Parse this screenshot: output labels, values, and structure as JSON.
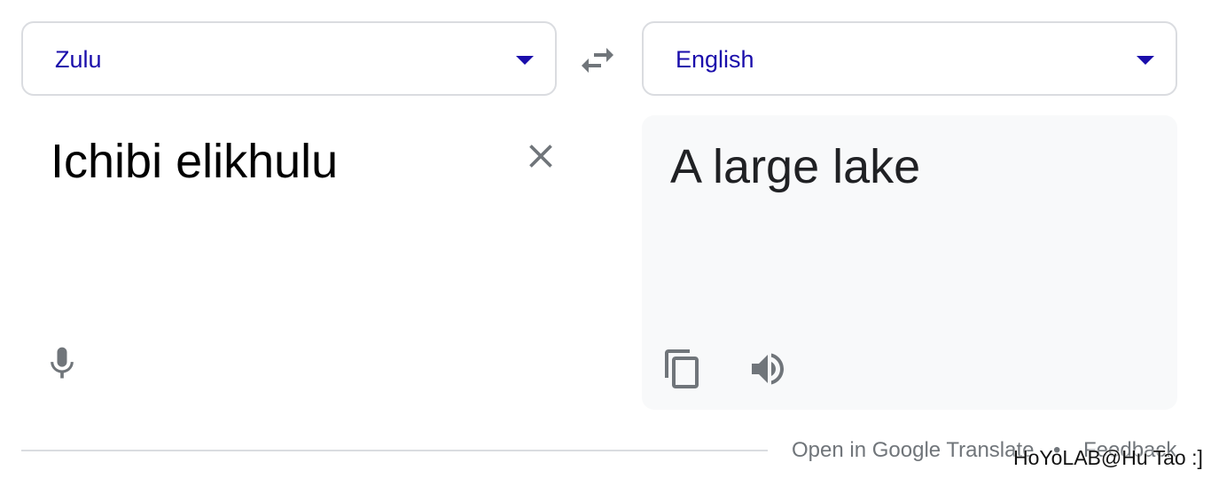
{
  "source_language": {
    "label": "Zulu"
  },
  "target_language": {
    "label": "English"
  },
  "input": {
    "text": "Ichibi elikhulu"
  },
  "output": {
    "text": "A large lake"
  },
  "footer": {
    "open_link": "Open in Google Translate",
    "separator": "•",
    "feedback_link": "Feedback"
  },
  "watermark": "HoYoLAB@Hu Tao :]",
  "colors": {
    "accent": "#1a0dab",
    "icon": "#70757a",
    "border": "#dadce0",
    "panel": "#f8f9fa"
  },
  "icons": {
    "swap": "swap-horiz-icon",
    "clear": "close-icon",
    "mic": "microphone-icon",
    "copy": "copy-icon",
    "speak": "volume-icon"
  }
}
